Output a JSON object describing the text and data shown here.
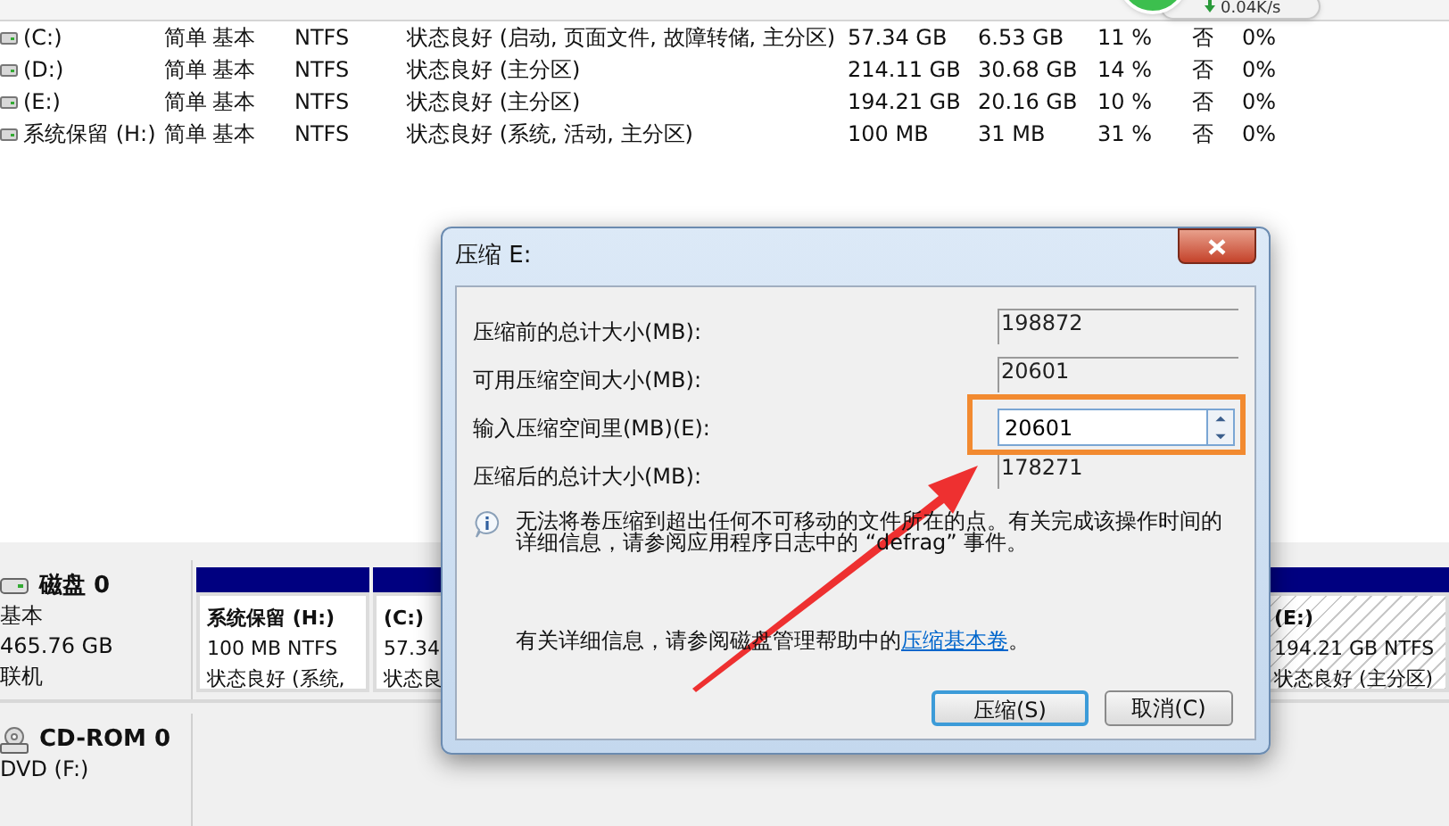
{
  "volumes_table": {
    "rows": [
      {
        "volume": "(C:)",
        "layout": "简单",
        "type": "基本",
        "file_system": "NTFS",
        "status": "状态良好 (启动, 页面文件, 故障转储, 主分区)",
        "capacity": "57.34 GB",
        "free": "6.53 GB",
        "percent_free": "11 %",
        "fault_tolerance": "否",
        "overhead": "0%"
      },
      {
        "volume": "(D:)",
        "layout": "简单",
        "type": "基本",
        "file_system": "NTFS",
        "status": "状态良好 (主分区)",
        "capacity": "214.11 GB",
        "free": "30.68 GB",
        "percent_free": "14 %",
        "fault_tolerance": "否",
        "overhead": "0%"
      },
      {
        "volume": "(E:)",
        "layout": "简单",
        "type": "基本",
        "file_system": "NTFS",
        "status": "状态良好 (主分区)",
        "capacity": "194.21 GB",
        "free": "20.16 GB",
        "percent_free": "10 %",
        "fault_tolerance": "否",
        "overhead": "0%"
      },
      {
        "volume": "系统保留 (H:)",
        "layout": "简单",
        "type": "基本",
        "file_system": "NTFS",
        "status": "状态良好 (系统, 活动, 主分区)",
        "capacity": "100 MB",
        "free": "31 MB",
        "percent_free": "31 %",
        "fault_tolerance": "否",
        "overhead": "0%"
      }
    ]
  },
  "network_widget": {
    "speed": "0.04K/s"
  },
  "disks": [
    {
      "kind": "disk",
      "name": "磁盘 0",
      "lines": [
        "基本",
        "465.76 GB",
        "联机"
      ],
      "partitions": [
        {
          "title": "系统保留 (H:)",
          "lines": [
            "100 MB NTFS",
            "状态良好 (系统,"
          ],
          "selected": false
        },
        {
          "title": "(C:)",
          "lines": [
            "57.34",
            "状态良"
          ],
          "selected": false
        },
        {
          "title": "(E:)",
          "lines": [
            "194.21 GB NTFS",
            "状态良好 (主分区)"
          ],
          "selected": true
        }
      ]
    },
    {
      "kind": "cdrom",
      "name": "CD-ROM 0",
      "lines": [
        "DVD (F:)"
      ]
    }
  ],
  "dialog": {
    "title": "压缩 E:",
    "fields": [
      {
        "kind": "readonly",
        "label": "压缩前的总计大小(MB):",
        "value": "198872"
      },
      {
        "kind": "readonly",
        "label": "可用压缩空间大小(MB):",
        "value": "20601"
      },
      {
        "kind": "spin",
        "label": "输入压缩空间里(MB)(E):",
        "value": "20601"
      },
      {
        "kind": "readonly",
        "label": "压缩后的总计大小(MB):",
        "value": "178271"
      }
    ],
    "info": "无法将卷压缩到超出任何不可移动的文件所在的点。有关完成该操作时间的详细信息，请参阅应用程序日志中的 “defrag” 事件。",
    "help_text": "有关详细信息，请参阅磁盘管理帮助中的",
    "help_link": "压缩基本卷",
    "help_suffix": "。",
    "buttons": [
      {
        "label": "压缩(S)",
        "default": true
      },
      {
        "label": "取消(C)",
        "default": false
      }
    ]
  }
}
